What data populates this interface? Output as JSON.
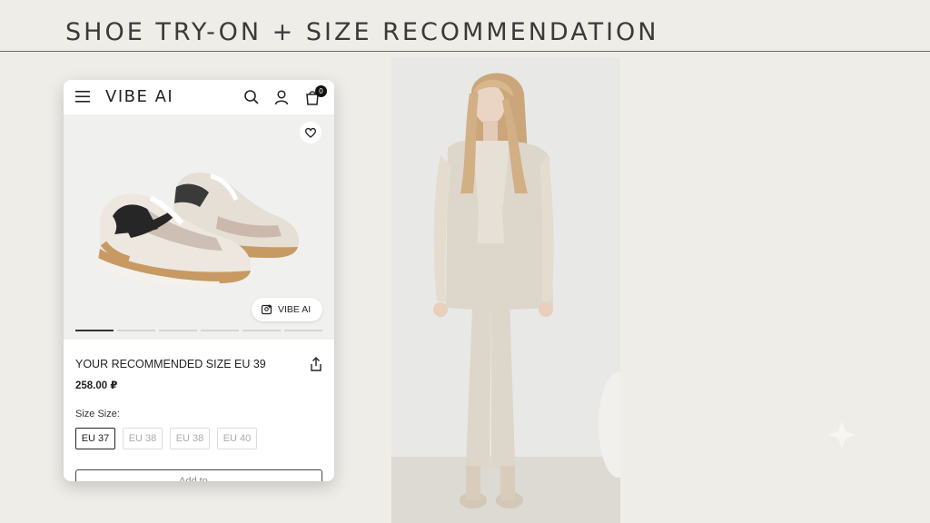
{
  "page": {
    "title": "SHOE TRY-ON + SIZE RECOMMENDATION"
  },
  "app": {
    "brand": "VIBE AI",
    "cart_count": "0",
    "icons": [
      "menu-icon",
      "search-icon",
      "account-icon",
      "cart-icon",
      "heart-icon",
      "share-icon"
    ]
  },
  "product": {
    "image_chip_label": "VIBE AI",
    "carousel": {
      "total": 6,
      "active_index": 0
    },
    "recommended_size_text": "YOUR RECOMMENDED SIZE EU 39",
    "price": "258.00 ₽",
    "size_label": "Size Size:",
    "sizes": [
      {
        "label": "EU 37",
        "selected": true
      },
      {
        "label": "EU 38",
        "selected": false
      },
      {
        "label": "EU 38",
        "selected": false
      },
      {
        "label": "EU 40",
        "selected": false
      }
    ],
    "add_button_label": "Add to ..."
  },
  "colors": {
    "background": "#efede8",
    "accent": "#222222",
    "outfit": "#ddd6ca"
  }
}
